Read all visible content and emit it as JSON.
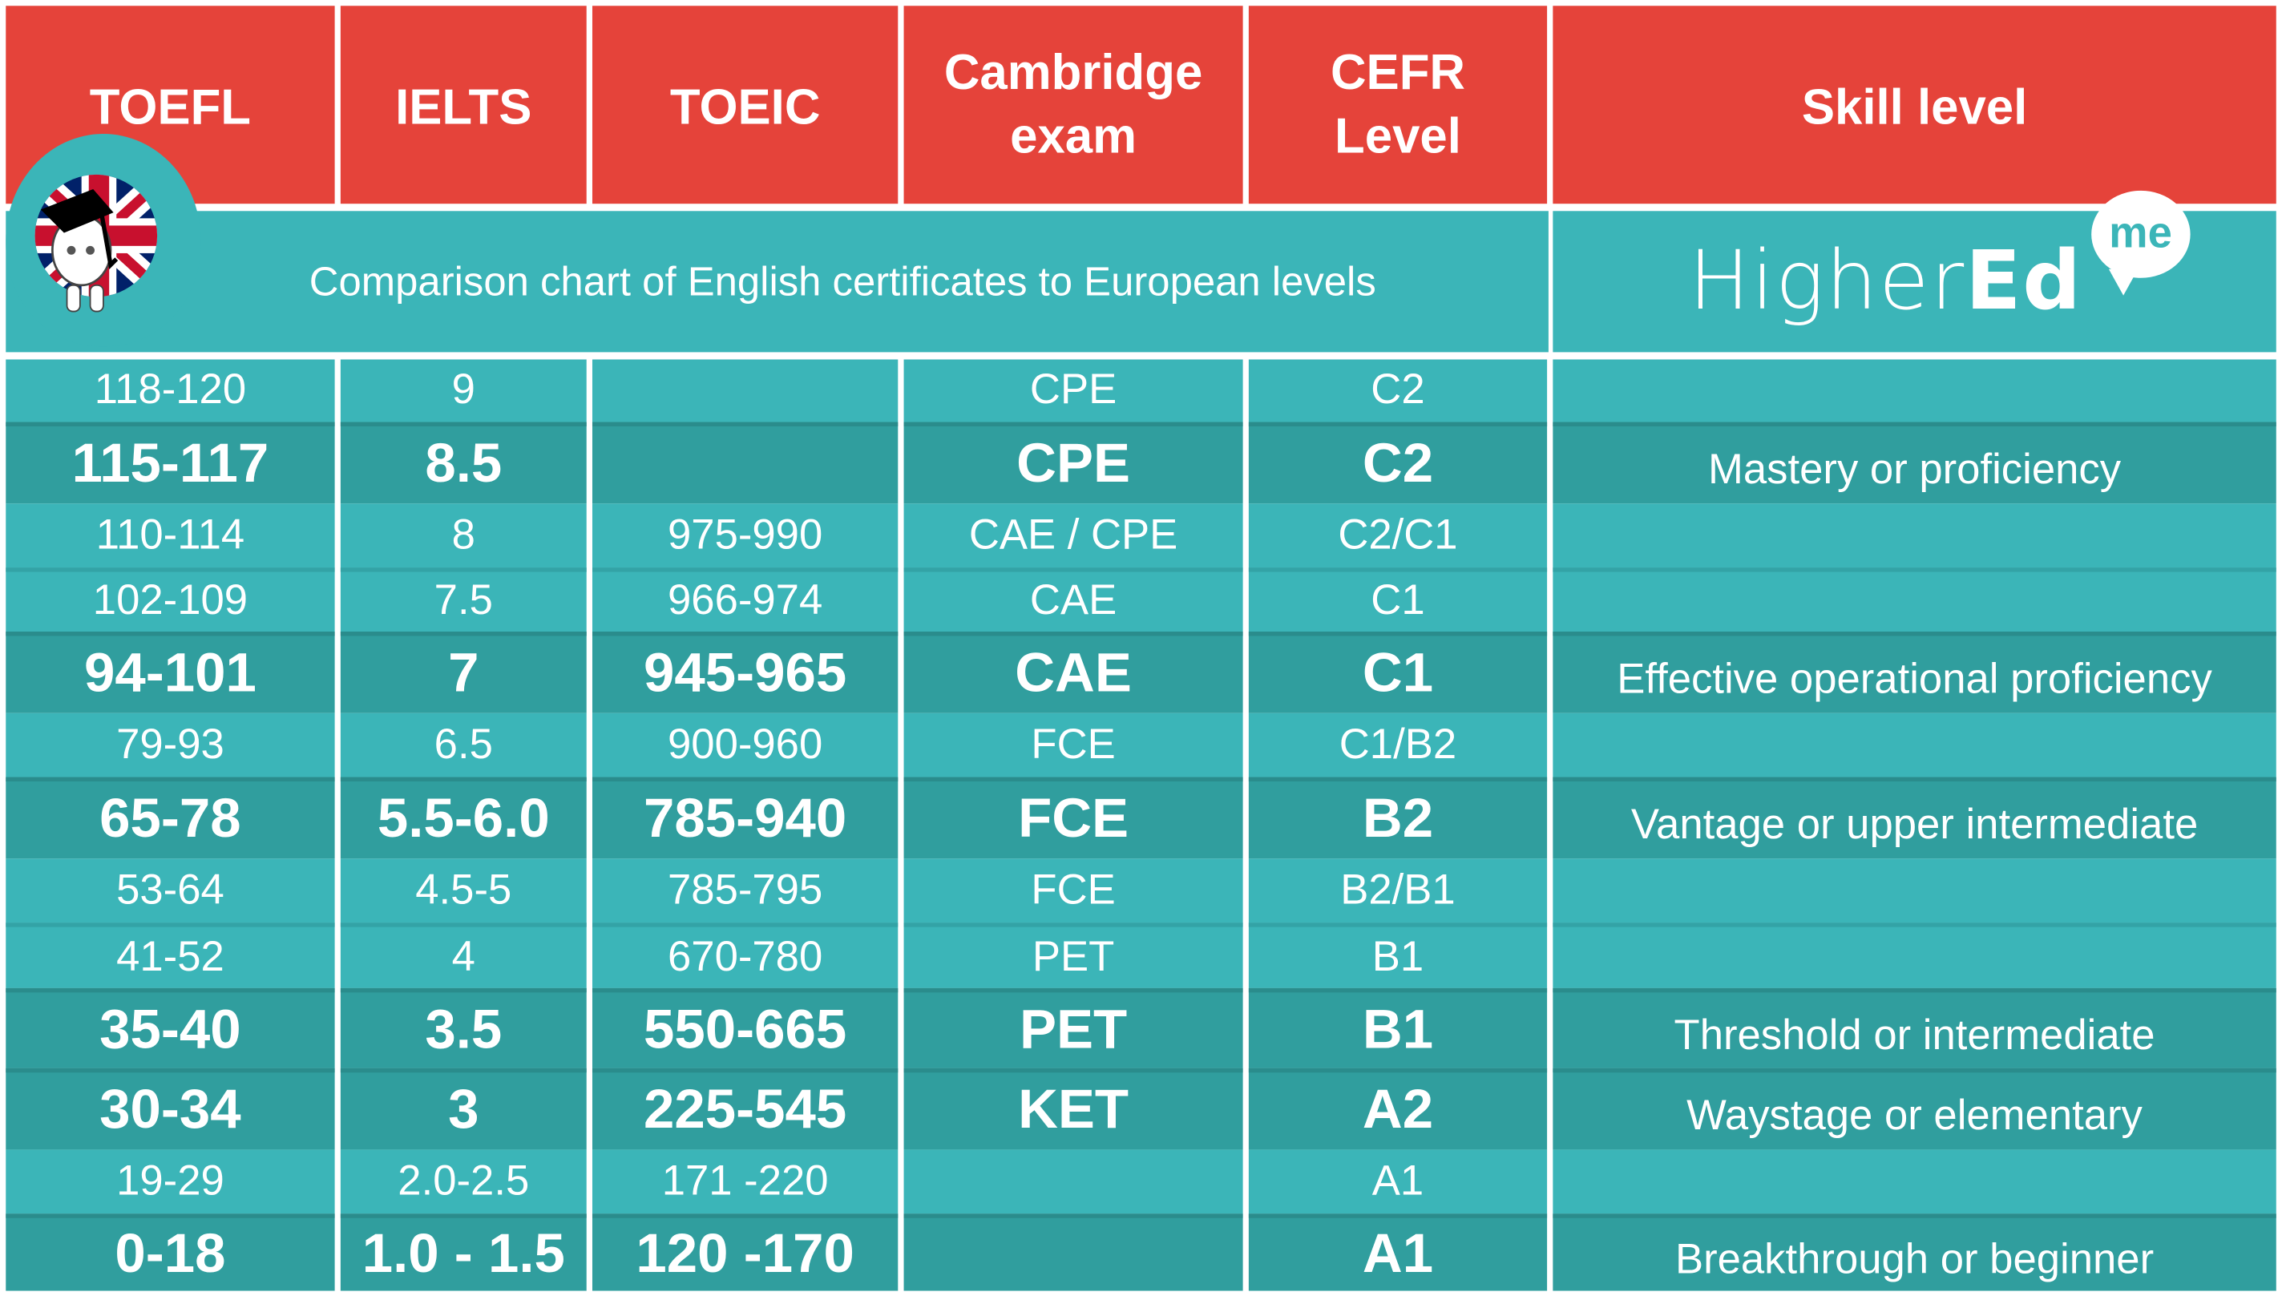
{
  "colors": {
    "header_red": "#E5433A",
    "teal_light": "#3BB5B8",
    "teal_dark": "#309E9E",
    "text": "#FFFFFF"
  },
  "header": {
    "columns": [
      {
        "lines": [
          "TOEFL"
        ]
      },
      {
        "lines": [
          "IELTS"
        ]
      },
      {
        "lines": [
          "TOEIC"
        ]
      },
      {
        "lines": [
          "Cambridge",
          "exam"
        ]
      },
      {
        "lines": [
          "CEFR",
          "Level"
        ]
      },
      {
        "lines": [
          "Skill level"
        ]
      }
    ]
  },
  "subtitle": "Comparison chart of English certificates to European levels",
  "brand": {
    "light": "Higher",
    "bold": "Ed",
    "bubble": "me"
  },
  "mascot_icon": "graduate-sheep-uk-flag-icon",
  "rows": [
    {
      "style": "light",
      "toefl": "118-120",
      "ielts": "9",
      "toeic": "",
      "cambridge": "CPE",
      "cefr": "C2",
      "skill": ""
    },
    {
      "style": "dark",
      "toefl": "115-117",
      "ielts": "8.5",
      "toeic": "",
      "cambridge": "CPE",
      "cefr": "C2",
      "skill": "Mastery or proficiency"
    },
    {
      "style": "light",
      "toefl": "110-114",
      "ielts": "8",
      "toeic": "975-990",
      "cambridge": "CAE / CPE",
      "cefr": "C2/C1",
      "skill": ""
    },
    {
      "style": "light",
      "toefl": "102-109",
      "ielts": "7.5",
      "toeic": "966-974",
      "cambridge": "CAE",
      "cefr": "C1",
      "skill": ""
    },
    {
      "style": "dark",
      "toefl": "94-101",
      "ielts": "7",
      "toeic": "945-965",
      "cambridge": "CAE",
      "cefr": "C1",
      "skill": "Effective operational proficiency"
    },
    {
      "style": "light",
      "toefl": "79-93",
      "ielts": "6.5",
      "toeic": "900-960",
      "cambridge": "FCE",
      "cefr": "C1/B2",
      "skill": ""
    },
    {
      "style": "dark",
      "toefl": "65-78",
      "ielts": "5.5-6.0",
      "toeic": "785-940",
      "cambridge": "FCE",
      "cefr": "B2",
      "skill": "Vantage or upper intermediate"
    },
    {
      "style": "light",
      "toefl": "53-64",
      "ielts": "4.5-5",
      "toeic": "785-795",
      "cambridge": "FCE",
      "cefr": "B2/B1",
      "skill": ""
    },
    {
      "style": "light",
      "toefl": "41-52",
      "ielts": "4",
      "toeic": "670-780",
      "cambridge": "PET",
      "cefr": "B1",
      "skill": ""
    },
    {
      "style": "dark",
      "toefl": "35-40",
      "ielts": "3.5",
      "toeic": "550-665",
      "cambridge": "PET",
      "cefr": "B1",
      "skill": "Threshold or intermediate"
    },
    {
      "style": "dark",
      "toefl": "30-34",
      "ielts": "3",
      "toeic": "225-545",
      "cambridge": "KET",
      "cefr": "A2",
      "skill": "Waystage or elementary"
    },
    {
      "style": "light",
      "toefl": "19-29",
      "ielts": "2.0-2.5",
      "toeic": "171 -220",
      "cambridge": "",
      "cefr": "A1",
      "skill": ""
    },
    {
      "style": "dark",
      "toefl": "0-18",
      "ielts": "1.0 - 1.5",
      "toeic": "120 -170",
      "cambridge": "",
      "cefr": "A1",
      "skill": "Breakthrough or beginner"
    }
  ]
}
